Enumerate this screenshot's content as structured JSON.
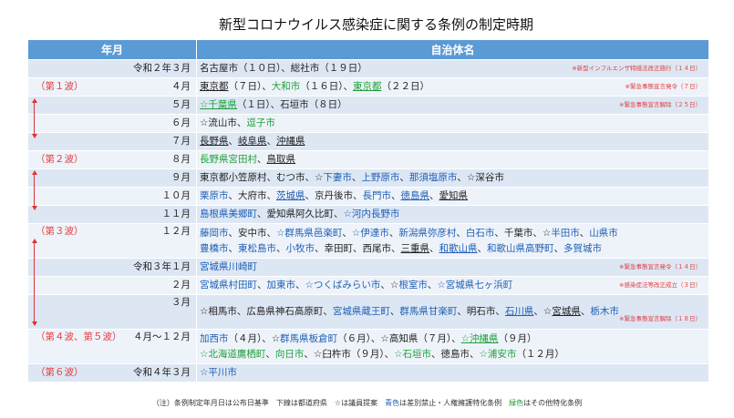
{
  "title": "新型コロナウイルス感染症に関する条例の制定時期",
  "headers": {
    "time": "年月",
    "body": "自治体名"
  },
  "rows": [
    {
      "wave": "",
      "month": "令和２年３月",
      "lines": [
        [
          {
            "t": "名古屋市（１０日）、総社市（１９日）"
          }
        ]
      ],
      "note": "※新型インフルエンザ特措法改正施行（１４日）"
    },
    {
      "wave": "（第１波）",
      "month": "４月",
      "lines": [
        [
          {
            "t": "東京都",
            "u": 1
          },
          {
            "t": "（７日）、"
          },
          {
            "t": "大和市",
            "c": "green"
          },
          {
            "t": "（１６日）、"
          },
          {
            "t": "東京都",
            "c": "green",
            "u": 1
          },
          {
            "t": "（２２日）"
          }
        ]
      ],
      "note": "※緊急事態宣言発令（７日）"
    },
    {
      "wave": "",
      "month": "５月",
      "lines": [
        [
          {
            "t": "☆千葉県",
            "c": "green",
            "u": 1
          },
          {
            "t": "（１日）、石垣市（８日）"
          }
        ]
      ],
      "note": "※緊急事態宣言解除（２５日）"
    },
    {
      "wave": "",
      "month": "６月",
      "lines": [
        [
          {
            "t": "☆流山市、"
          },
          {
            "t": "逗子市",
            "c": "green"
          }
        ]
      ]
    },
    {
      "wave": "",
      "month": "７月",
      "lines": [
        [
          {
            "t": "長野県",
            "u": 1
          },
          {
            "t": "、"
          },
          {
            "t": "岐阜県",
            "u": 1
          },
          {
            "t": "、"
          },
          {
            "t": "沖縄県",
            "u": 1
          }
        ]
      ]
    },
    {
      "wave": "（第２波）",
      "month": "８月",
      "lines": [
        [
          {
            "t": "長野県宮田村",
            "c": "green"
          },
          {
            "t": "、"
          },
          {
            "t": "鳥取県",
            "u": 1
          }
        ]
      ]
    },
    {
      "wave": "",
      "month": "９月",
      "lines": [
        [
          {
            "t": "東京都小笠原村、むつ市、☆"
          },
          {
            "t": "下妻市",
            "c": "blue"
          },
          {
            "t": "、"
          },
          {
            "t": "上野原市",
            "c": "blue"
          },
          {
            "t": "、"
          },
          {
            "t": "那須塩原市",
            "c": "blue"
          },
          {
            "t": "、☆深谷市"
          }
        ]
      ]
    },
    {
      "wave": "",
      "month": "１０月",
      "lines": [
        [
          {
            "t": "栗原市",
            "c": "blue"
          },
          {
            "t": "、大府市、"
          },
          {
            "t": "茨城県",
            "c": "blue",
            "u": 1
          },
          {
            "t": "、京丹後市、"
          },
          {
            "t": "長門市",
            "c": "blue"
          },
          {
            "t": "、"
          },
          {
            "t": "徳島県",
            "c": "blue",
            "u": 1
          },
          {
            "t": "、"
          },
          {
            "t": "愛知県",
            "u": 1
          }
        ]
      ]
    },
    {
      "wave": "",
      "month": "１１月",
      "lines": [
        [
          {
            "t": "島根県美郷町",
            "c": "blue"
          },
          {
            "t": "、愛知県阿久比町、"
          },
          {
            "t": "☆河内長野市",
            "c": "blue"
          }
        ]
      ]
    },
    {
      "wave": "（第３波）",
      "month": "１２月",
      "tall": 1,
      "lines": [
        [
          {
            "t": "藤岡市",
            "c": "blue"
          },
          {
            "t": "、安中市、"
          },
          {
            "t": "☆群馬県邑楽町",
            "c": "blue"
          },
          {
            "t": "、"
          },
          {
            "t": "☆伊達市",
            "c": "blue"
          },
          {
            "t": "、"
          },
          {
            "t": "新潟県弥彦村",
            "c": "blue"
          },
          {
            "t": "、"
          },
          {
            "t": "白石市",
            "c": "blue"
          },
          {
            "t": "、千葉市、☆"
          },
          {
            "t": "半田市",
            "c": "blue"
          },
          {
            "t": "、"
          },
          {
            "t": "山県市",
            "c": "blue"
          }
        ],
        [
          {
            "t": "豊橋市",
            "c": "blue"
          },
          {
            "t": "、"
          },
          {
            "t": "東松島市",
            "c": "blue"
          },
          {
            "t": "、"
          },
          {
            "t": "小牧市",
            "c": "blue"
          },
          {
            "t": "、幸田町、西尾市、"
          },
          {
            "t": "三重県",
            "u": 1
          },
          {
            "t": "、"
          },
          {
            "t": "和歌山県",
            "c": "blue",
            "u": 1
          },
          {
            "t": "、"
          },
          {
            "t": "和歌山県高野町",
            "c": "blue"
          },
          {
            "t": "、"
          },
          {
            "t": "多賀城市",
            "c": "blue"
          }
        ]
      ]
    },
    {
      "wave": "",
      "month": "令和３年１月",
      "lines": [
        [
          {
            "t": "宮城県川崎町",
            "c": "blue"
          }
        ]
      ],
      "note": "※緊急事態宣言発令（１４日）"
    },
    {
      "wave": "",
      "month": "２月",
      "lines": [
        [
          {
            "t": "宮城県村田町",
            "c": "blue"
          },
          {
            "t": "、"
          },
          {
            "t": "加東市",
            "c": "blue"
          },
          {
            "t": "、"
          },
          {
            "t": "☆つくばみらい市",
            "c": "blue"
          },
          {
            "t": "、☆"
          },
          {
            "t": "根室市",
            "c": "blue"
          },
          {
            "t": "、"
          },
          {
            "t": "☆宮城県七ヶ浜町",
            "c": "blue"
          }
        ]
      ],
      "note": "※感染症法等改正成立（３日）"
    },
    {
      "wave": "",
      "month": "３月",
      "tall": 1,
      "lines": [
        [
          {
            "t": "☆相馬市、広島県神石高原町、"
          },
          {
            "t": "宮城県蔵王町",
            "c": "blue"
          },
          {
            "t": "、"
          },
          {
            "t": "群馬県甘楽町",
            "c": "blue"
          },
          {
            "t": "、明石市、"
          },
          {
            "t": "石川県",
            "c": "blue",
            "u": 1
          },
          {
            "t": "、☆"
          },
          {
            "t": "宮城県",
            "u": 1
          },
          {
            "t": "、"
          },
          {
            "t": "栃木市",
            "c": "blue"
          }
        ]
      ],
      "note2": "※緊急事態宣言解除（１８日）"
    },
    {
      "wave": "（第４波、第５波）",
      "month": "４月～１２月",
      "tall": 1,
      "lines": [
        [
          {
            "t": "加西市",
            "c": "blue"
          },
          {
            "t": "（４月）、☆"
          },
          {
            "t": "群馬県板倉町",
            "c": "blue"
          },
          {
            "t": "（６月）、☆高知県（７月）、"
          },
          {
            "t": "☆沖縄県",
            "c": "green",
            "u": 1
          },
          {
            "t": "（９月）"
          }
        ],
        [
          {
            "t": "☆北海道鷹栖町",
            "c": "green"
          },
          {
            "t": "、"
          },
          {
            "t": "向日市",
            "c": "green"
          },
          {
            "t": "、☆臼杵市（９月）、"
          },
          {
            "t": "☆石垣市",
            "c": "green"
          },
          {
            "t": "、徳島市、"
          },
          {
            "t": "☆浦安市",
            "c": "green"
          },
          {
            "t": "（１２月）"
          }
        ]
      ]
    },
    {
      "wave": "（第６波）",
      "month": "令和４年３月",
      "lines": [
        [
          {
            "t": "☆平川市",
            "c": "blue"
          }
        ]
      ]
    }
  ],
  "footnote": [
    {
      "t": "（注）条例制定年月日は公布日基準　下線は都道府県　☆は議員提案　"
    },
    {
      "t": "青色",
      "c": "b"
    },
    {
      "t": "は差別禁止・人権擁護特化条例　"
    },
    {
      "t": "緑色",
      "c": "g"
    },
    {
      "t": "はその他特化条例"
    }
  ],
  "colors": {
    "header": "#5b9bd5",
    "row_odd": "#dde7f4",
    "row_even": "#eef3fa",
    "wave_red": "#e23b3b",
    "blue_text": "#1f5fb5",
    "green_text": "#1ea03b"
  }
}
